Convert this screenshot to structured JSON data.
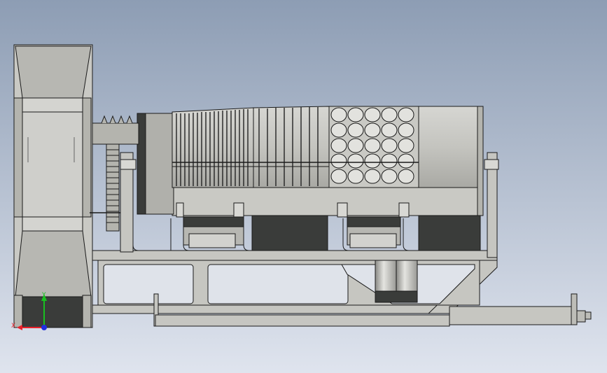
{
  "colors": {
    "background_top": "#8d9db4",
    "background_bottom": "#dfe4ee",
    "part_light": "#c9c9c4",
    "part_mid": "#b4b4ae",
    "part_dark": "#3a3c3a",
    "edge": "#1a1a1a",
    "axis_x": "#e8202a",
    "axis_y": "#18c020",
    "axis_z": "#2030e0"
  },
  "axis_triad": {
    "x_label": "X",
    "y_label": "Y"
  },
  "parts": [
    "blower-fan-housing",
    "drive-gear",
    "feed-screw",
    "slotted-screen-drum",
    "perforated-screen-drum",
    "drum-end-cap",
    "support-frame",
    "collection-hoppers",
    "discharge-outlets",
    "adjuster-rod"
  ]
}
